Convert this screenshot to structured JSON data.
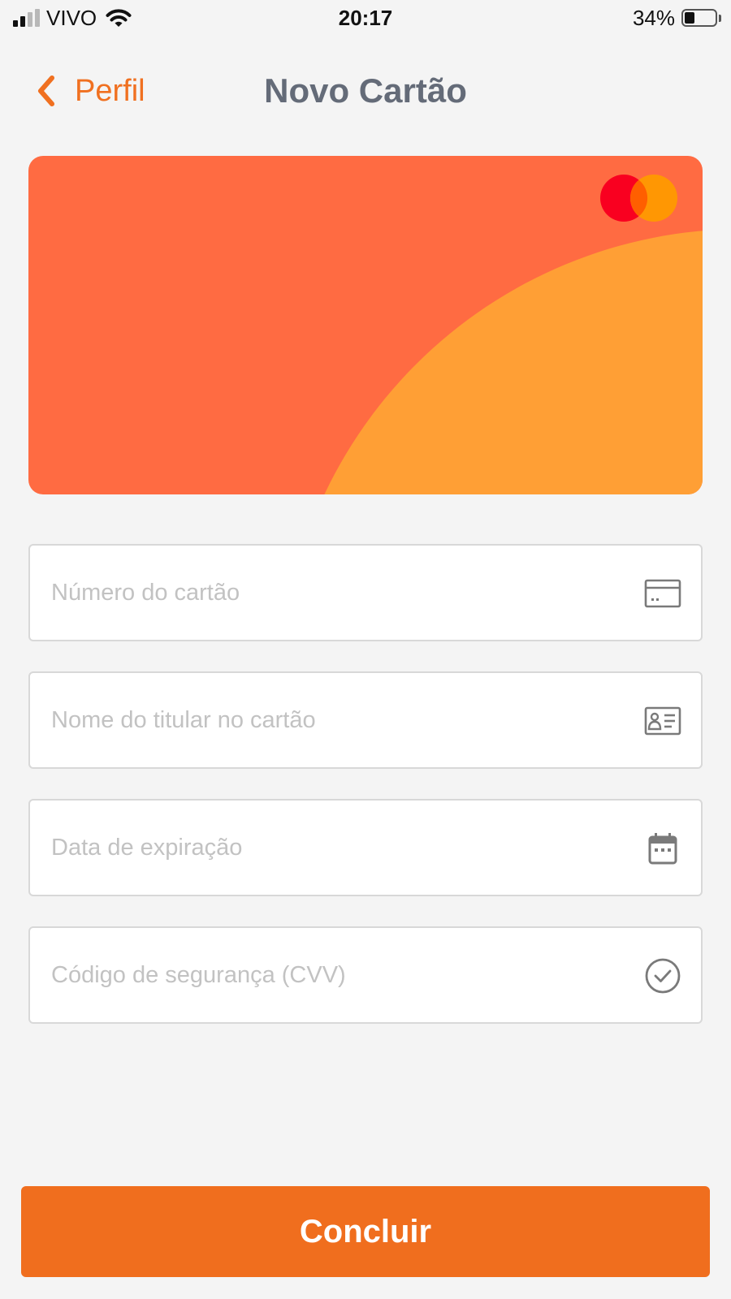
{
  "status_bar": {
    "carrier": "VIVO",
    "time": "20:17",
    "battery_percent": "34%",
    "battery_level": 0.34,
    "signal_bars": 2
  },
  "nav": {
    "back_label": "Perfil",
    "title": "Novo Cartão"
  },
  "card": {
    "brand_icon": "mastercard-logo",
    "colors": {
      "background": "#ff6b42",
      "arc": "#ff9f35",
      "logo_left": "#f90020",
      "logo_right": "#ff9a00"
    }
  },
  "form": {
    "fields": [
      {
        "placeholder": "Número do cartão",
        "value": "",
        "icon": "credit-card-icon"
      },
      {
        "placeholder": "Nome do titular no cartão",
        "value": "",
        "icon": "id-card-icon"
      },
      {
        "placeholder": "Data de expiração",
        "value": "",
        "icon": "calendar-icon"
      },
      {
        "placeholder": "Código de segurança (CVV)",
        "value": "",
        "icon": "check-circle-icon"
      }
    ]
  },
  "submit_label": "Concluir",
  "colors": {
    "accent": "#f06e1e",
    "title": "#646b78",
    "background": "#f4f4f4",
    "placeholder": "#c2c2c2",
    "icon": "#7a7a7a"
  }
}
